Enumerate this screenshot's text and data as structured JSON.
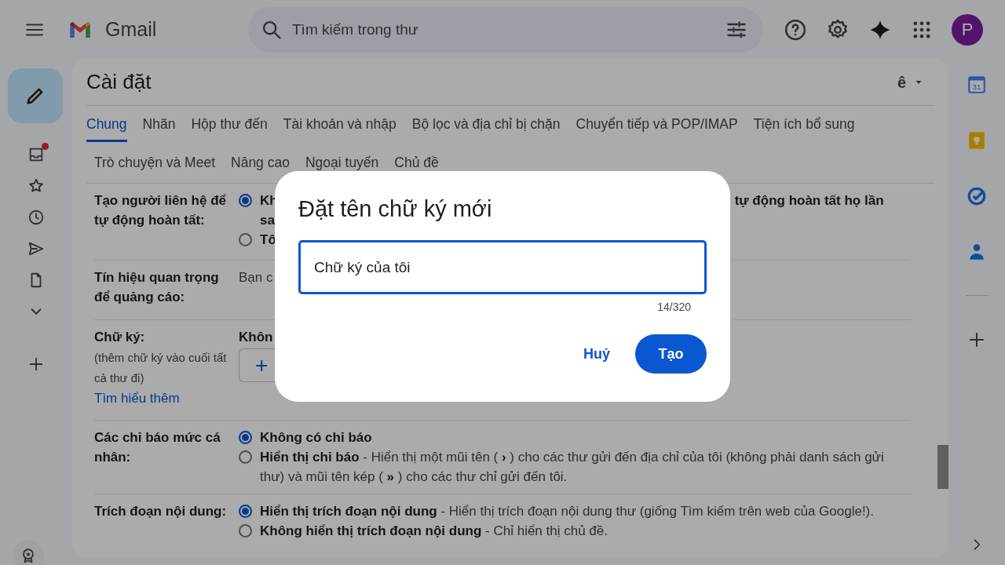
{
  "app": {
    "name": "Gmail"
  },
  "search": {
    "placeholder": "Tìm kiếm trong thư"
  },
  "account": {
    "initial": "P"
  },
  "nav": [
    {
      "kind": "inbox",
      "unread": true
    },
    {
      "kind": "star",
      "unread": false
    },
    {
      "kind": "clock",
      "unread": false
    },
    {
      "kind": "send",
      "unread": false
    },
    {
      "kind": "file",
      "unread": false
    },
    {
      "kind": "more",
      "unread": false
    }
  ],
  "side_apps": [
    {
      "kind": "calendar",
      "day": "31"
    },
    {
      "kind": "keep"
    },
    {
      "kind": "tasks"
    },
    {
      "kind": "contacts"
    }
  ],
  "settings": {
    "title": "Cài đặt",
    "input_tool": "ê",
    "tabs": [
      [
        {
          "label": "Chung",
          "selected": true
        },
        {
          "label": "Nhãn",
          "selected": false
        },
        {
          "label": "Hộp thư đến",
          "selected": false
        },
        {
          "label": "Tài khoản và nhập",
          "selected": false
        },
        {
          "label": "Bộ lọc và địa chỉ bị chặn",
          "selected": false
        },
        {
          "label": "Chuyển tiếp và POP/IMAP",
          "selected": false
        },
        {
          "label": "Tiện ích bổ sung",
          "selected": false
        }
      ],
      [
        {
          "label": "Trò chuyện và Meet",
          "selected": false
        },
        {
          "label": "Nâng cao",
          "selected": false
        },
        {
          "label": "Ngoại tuyến",
          "selected": false
        },
        {
          "label": "Chủ đề",
          "selected": false
        }
      ]
    ],
    "rows": [
      {
        "kind": "partial",
        "label": "Tạo người liên hệ để tự động hoàn tất:",
        "options": [
          {
            "selected": true,
            "text": "Kh",
            "continuation": "sa",
            "tail": "tự động hoàn tất họ lần"
          },
          {
            "selected": false,
            "text": "Tô"
          }
        ]
      },
      {
        "kind": "text",
        "label": "Tín hiệu quan trọng để quảng cáo:",
        "value": "Bạn c"
      },
      {
        "kind": "signature",
        "label": "Chữ ký:",
        "note": "(thêm chữ ký vào cuối tất cả thư đi)",
        "link": "Tìm hiểu thêm",
        "value": "Khôn",
        "add": "+"
      },
      {
        "kind": "options",
        "label": "Các chỉ báo mức cá nhân:",
        "options": [
          {
            "selected": true,
            "text": "**Không có chỉ báo**"
          },
          {
            "selected": false,
            "text": "**Hiển thị chỉ báo** - Hiển thị một mũi tên ( **›** ) cho các thư gửi đến địa chỉ của tôi (không phải danh sách gửi thư) và mũi tên kép ( **»** ) cho các thư chỉ gửi đến tôi."
          }
        ]
      },
      {
        "kind": "options",
        "label": "Trích đoạn nội dung:",
        "options": [
          {
            "selected": true,
            "text": "**Hiển thị trích đoạn nội dung** - Hiển thị trích đoạn nội dung thư (giống Tìm kiếm trên web của Google!)."
          },
          {
            "selected": false,
            "text": "**Không hiển thị trích đoạn nội dung** - Chỉ hiển thị chủ đề."
          }
        ]
      }
    ]
  },
  "dialog": {
    "title": "Đặt tên chữ ký mới",
    "value": "Chữ ký của tôi",
    "counter": "14/320",
    "buttons": [
      {
        "kind": "text",
        "label": "Huỷ"
      },
      {
        "kind": "filled",
        "label": "Tạo"
      }
    ]
  }
}
